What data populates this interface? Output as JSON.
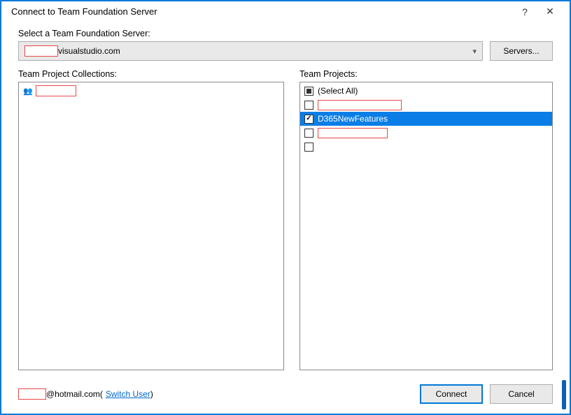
{
  "dialog": {
    "title": "Connect to Team Foundation Server",
    "help_symbol": "?",
    "close_symbol": "✕"
  },
  "server": {
    "label": "Select a Team Foundation Server:",
    "redacted_prefix": "",
    "value_suffix": "visualstudio.com",
    "servers_button": "Servers..."
  },
  "collections": {
    "label": "Team Project Collections:",
    "items": [
      {
        "redacted": true,
        "name": ""
      }
    ]
  },
  "projects": {
    "label": "Team Projects:",
    "select_all": "(Select All)",
    "items": [
      {
        "name": "",
        "redacted": true,
        "checked": false,
        "selected": false
      },
      {
        "name": "D365NewFeatures",
        "redacted": false,
        "checked": true,
        "selected": true
      },
      {
        "name": "",
        "redacted": true,
        "checked": false,
        "selected": false
      },
      {
        "name": "",
        "redacted": true,
        "checked": false,
        "selected": false
      }
    ]
  },
  "footer": {
    "user_suffix": "@hotmail.com",
    "switch_user_prefix": " (",
    "switch_user": "Switch User",
    "switch_user_suffix": ")",
    "connect": "Connect",
    "cancel": "Cancel"
  }
}
